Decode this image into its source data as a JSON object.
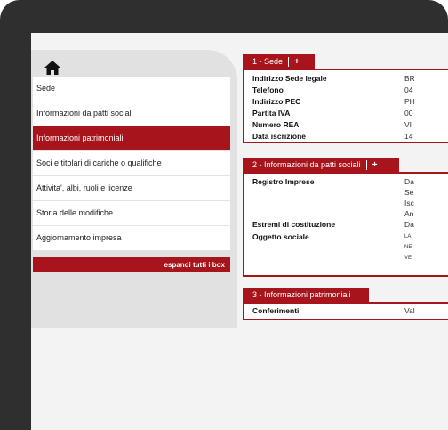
{
  "sidebar": {
    "items": [
      {
        "label": "Sede"
      },
      {
        "label": "Informazioni da patti sociali"
      },
      {
        "label": "Informazioni patrimoniali"
      },
      {
        "label": "Soci e titolari di cariche o qualifiche"
      },
      {
        "label": "Attivita', albi, ruoli e licenze"
      },
      {
        "label": "Storia delle modifiche"
      },
      {
        "label": "Aggiornamento impresa"
      }
    ],
    "active_index": 2,
    "expand_label": "espandi tutti i box"
  },
  "boxes": [
    {
      "title": "1 - Sede",
      "plus": "+",
      "fields": [
        {
          "label": "Indirizzo Sede legale",
          "value": "BR"
        },
        {
          "label": "Telefono",
          "value": "04"
        },
        {
          "label": "Indirizzo PEC",
          "value": "PH"
        },
        {
          "label": "Partita IVA",
          "value": "00"
        },
        {
          "label": "Numero REA",
          "value": "VI"
        },
        {
          "label": "Data iscrizione",
          "value": "14"
        }
      ]
    },
    {
      "title": "2 - Informazioni da patti sociali",
      "plus": "+",
      "fields": [
        {
          "label": "Registro Imprese",
          "values": [
            "Da",
            "Se",
            "Isc",
            "An"
          ]
        },
        {
          "label": "Estremi di costituzione",
          "value": "Da"
        },
        {
          "label": "Oggetto sociale",
          "values": [
            "LA",
            "NE",
            "VE"
          ]
        }
      ]
    },
    {
      "title": "3 - Informazioni patrimoniali",
      "fields": [
        {
          "label": "Conferimenti",
          "value": "Val"
        }
      ]
    }
  ],
  "colors": {
    "accent": "#a8141b",
    "frame": "#2f2f2f",
    "panel": "#e1e1e1"
  },
  "icons": {
    "home": "home-icon",
    "plus": "plus-icon"
  }
}
